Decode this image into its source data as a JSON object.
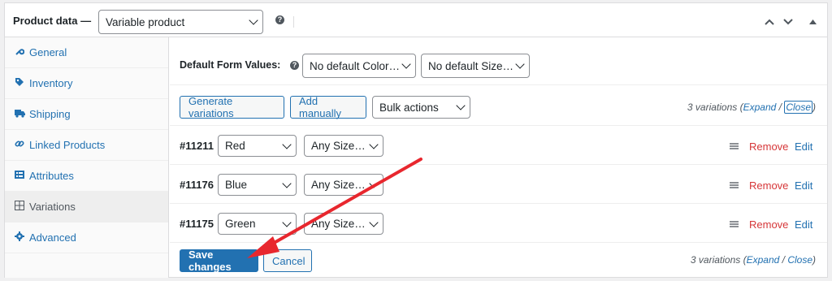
{
  "header": {
    "title": "Product data —",
    "product_type": "Variable product",
    "help_symbol": "?"
  },
  "sidebar": {
    "items": [
      {
        "label": "General",
        "icon": "wrench-icon",
        "glyph": "🔧"
      },
      {
        "label": "Inventory",
        "icon": "tag-icon",
        "glyph": "◈"
      },
      {
        "label": "Shipping",
        "icon": "truck-icon",
        "glyph": "■"
      },
      {
        "label": "Linked Products",
        "icon": "link-icon",
        "glyph": "∞"
      },
      {
        "label": "Attributes",
        "icon": "list-icon",
        "glyph": "☰"
      },
      {
        "label": "Variations",
        "icon": "grid-icon",
        "glyph": "⊞"
      },
      {
        "label": "Advanced",
        "icon": "gear-icon",
        "glyph": "✱"
      }
    ]
  },
  "defaults": {
    "label": "Default Form Values:",
    "color_select": "No default Color…",
    "size_select": "No default Size…"
  },
  "toolbar": {
    "generate": "Generate variations",
    "add_manually": "Add manually",
    "bulk_actions": "Bulk actions",
    "count": "3 variations (",
    "expand": "Expand",
    "slash": " / ",
    "close": "Close",
    "paren": ")"
  },
  "variations": [
    {
      "id": "#11211",
      "color": "Red",
      "size": "Any Size…"
    },
    {
      "id": "#11176",
      "color": "Blue",
      "size": "Any Size…"
    },
    {
      "id": "#11175",
      "color": "Green",
      "size": "Any Size…"
    }
  ],
  "actions": {
    "remove": "Remove",
    "edit": "Edit"
  },
  "footer": {
    "save": "Save changes",
    "cancel": "Cancel"
  },
  "colors": {
    "accent": "#2271b1",
    "danger": "#d63638",
    "annotation_arrow": "#e8272e"
  }
}
